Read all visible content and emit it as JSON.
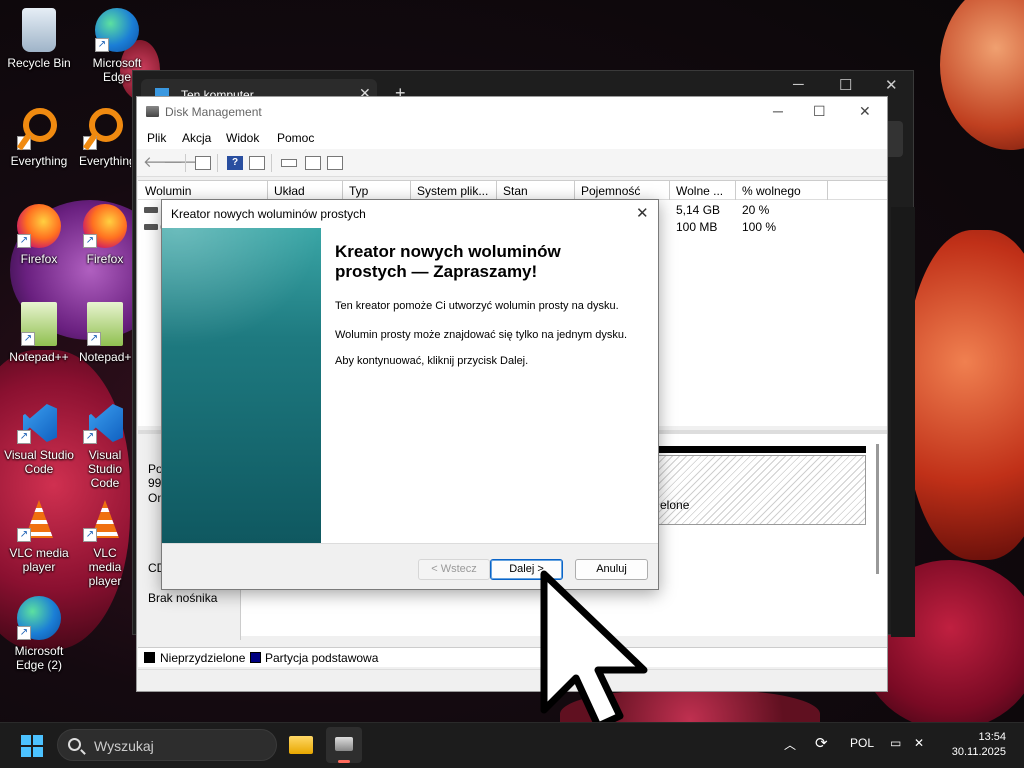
{
  "desktop": {
    "icons": [
      {
        "label": "Recycle Bin",
        "icon": "recycle-bin-icon"
      },
      {
        "label": "Microsoft Edge",
        "icon": "edge-icon"
      },
      {
        "label": "Everything",
        "icon": "everything-icon"
      },
      {
        "label": "Everything",
        "icon": "everything-icon"
      },
      {
        "label": "Firefox",
        "icon": "firefox-icon"
      },
      {
        "label": "Firefox",
        "icon": "firefox-icon"
      },
      {
        "label": "Notepad++",
        "icon": "notepadpp-icon"
      },
      {
        "label": "Notepad++",
        "icon": "notepadpp-icon"
      },
      {
        "label": "Visual Studio Code",
        "icon": "vscode-icon"
      },
      {
        "label": "Visual Studio Code",
        "icon": "vscode-icon"
      },
      {
        "label": "VLC media player",
        "icon": "vlc-icon"
      },
      {
        "label": "VLC media player",
        "icon": "vlc-icon"
      },
      {
        "label": "Microsoft Edge (2)",
        "icon": "edge-icon"
      }
    ]
  },
  "explorer": {
    "tab_title": "Ten komputer",
    "new_tab": "+",
    "minimize": "─",
    "maximize": "☐",
    "close": "✕"
  },
  "disk_management": {
    "title": "Disk Management",
    "minimize": "─",
    "maximize": "☐",
    "close": "✕",
    "menu": [
      "Plik",
      "Akcja",
      "Widok",
      "Pomoc"
    ],
    "columns": [
      "Wolumin",
      "Układ",
      "Typ",
      "System plik...",
      "Stan",
      "Pojemność",
      "Wolne ...",
      "% wolnego"
    ],
    "rows": [
      {
        "volume": "",
        "free": "5,14 GB",
        "pct_free": "20 %"
      },
      {
        "volume": "(",
        "free": "100 MB",
        "pct_free": "100 %"
      }
    ],
    "graph": {
      "disk0_lines": [
        "Po",
        "99,",
        "On"
      ],
      "cd_label": "CD",
      "no_media": "Brak nośnika",
      "unallocated_partial": "elone"
    },
    "legend": [
      {
        "label": "Nieprzydzielone",
        "color": "#000000"
      },
      {
        "label": "Partycja podstawowa",
        "color": "#000080"
      }
    ]
  },
  "wizard": {
    "title": "Kreator nowych woluminów prostych",
    "close": "✕",
    "heading": "Kreator nowych woluminów prostych — Zapraszamy!",
    "paragraphs": [
      "Ten kreator pomoże Ci utworzyć wolumin prosty na dysku.",
      "Wolumin prosty może znajdować się tylko na jednym dysku.",
      "Aby kontynuować, kliknij przycisk Dalej."
    ],
    "buttons": {
      "back": "< Wstecz",
      "next": "Dalej >",
      "cancel": "Anuluj"
    }
  },
  "taskbar": {
    "search_placeholder": "Wyszukaj",
    "language": "POL",
    "time": "13:54",
    "date": "30.11.2025",
    "tray_chevron": "︿"
  },
  "colors": {
    "accent": "#0a64c8",
    "wizard_side": "#1e7a80"
  }
}
